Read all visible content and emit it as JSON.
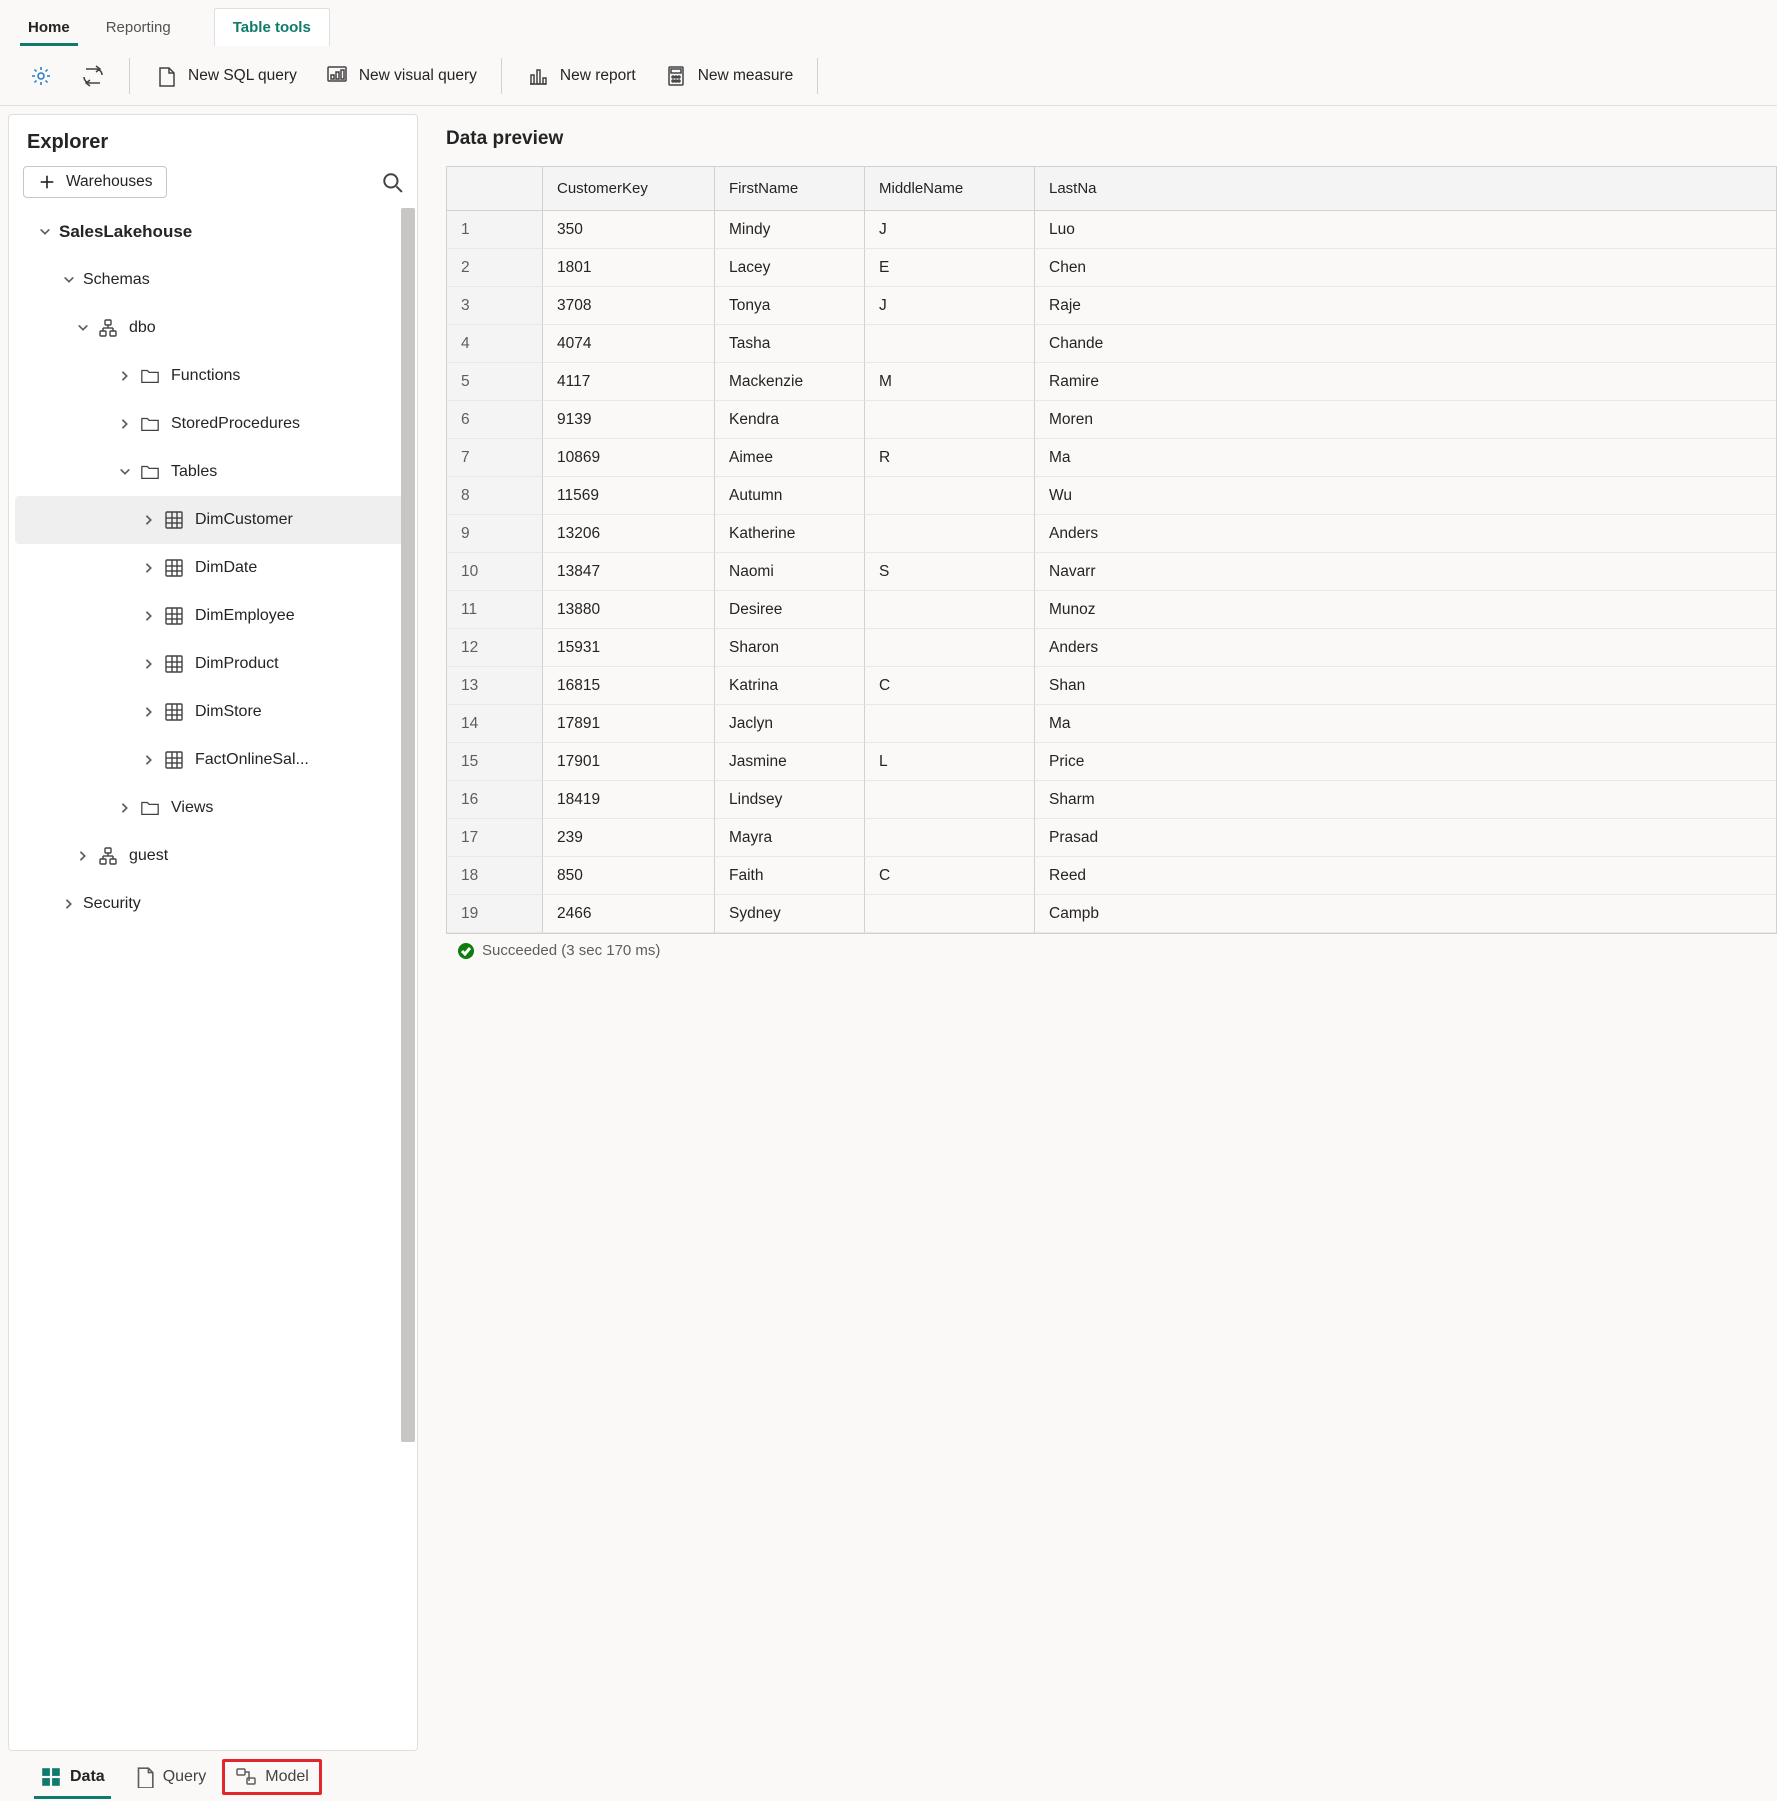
{
  "ribbonTabs": {
    "home": "Home",
    "reporting": "Reporting",
    "tableTools": "Table tools"
  },
  "ribbon": {
    "newSql": "New SQL query",
    "newVisual": "New visual query",
    "newReport": "New report",
    "newMeasure": "New measure"
  },
  "explorer": {
    "title": "Explorer",
    "warehousesBtn": "Warehouses",
    "root": "SalesLakehouse",
    "schemas": "Schemas",
    "dbo": "dbo",
    "functions": "Functions",
    "storedProcedures": "StoredProcedures",
    "tablesLabel": "Tables",
    "tables": [
      "DimCustomer",
      "DimDate",
      "DimEmployee",
      "DimProduct",
      "DimStore",
      "FactOnlineSal..."
    ],
    "views": "Views",
    "guest": "guest",
    "security": "Security"
  },
  "preview": {
    "title": "Data preview",
    "columns": [
      "CustomerKey",
      "FirstName",
      "MiddleName",
      "LastNa"
    ],
    "rows": [
      [
        "1",
        "350",
        "Mindy",
        "J",
        "Luo"
      ],
      [
        "2",
        "1801",
        "Lacey",
        "E",
        "Chen"
      ],
      [
        "3",
        "3708",
        "Tonya",
        "J",
        "Raje"
      ],
      [
        "4",
        "4074",
        "Tasha",
        "",
        "Chande"
      ],
      [
        "5",
        "4117",
        "Mackenzie",
        "M",
        "Ramire"
      ],
      [
        "6",
        "9139",
        "Kendra",
        "",
        "Moren"
      ],
      [
        "7",
        "10869",
        "Aimee",
        "R",
        "Ma"
      ],
      [
        "8",
        "11569",
        "Autumn",
        "",
        "Wu"
      ],
      [
        "9",
        "13206",
        "Katherine",
        "",
        "Anders"
      ],
      [
        "10",
        "13847",
        "Naomi",
        "S",
        "Navarr"
      ],
      [
        "11",
        "13880",
        "Desiree",
        "",
        "Munoz"
      ],
      [
        "12",
        "15931",
        "Sharon",
        "",
        "Anders"
      ],
      [
        "13",
        "16815",
        "Katrina",
        "C",
        "Shan"
      ],
      [
        "14",
        "17891",
        "Jaclyn",
        "",
        "Ma"
      ],
      [
        "15",
        "17901",
        "Jasmine",
        "L",
        "Price"
      ],
      [
        "16",
        "18419",
        "Lindsey",
        "",
        "Sharm"
      ],
      [
        "17",
        "239",
        "Mayra",
        "",
        "Prasad"
      ],
      [
        "18",
        "850",
        "Faith",
        "C",
        "Reed"
      ],
      [
        "19",
        "2466",
        "Sydney",
        "",
        "Campb"
      ]
    ],
    "status": "Succeeded (3 sec 170 ms)"
  },
  "viewTabs": {
    "data": "Data",
    "query": "Query",
    "model": "Model"
  }
}
